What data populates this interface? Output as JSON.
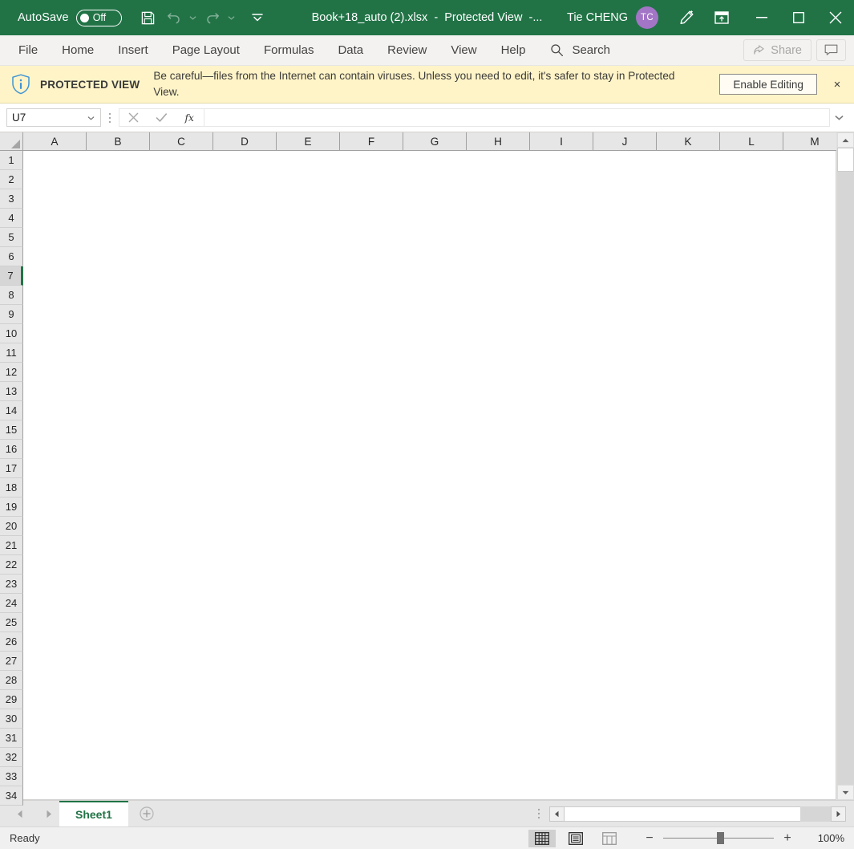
{
  "titlebar": {
    "autosave_label": "AutoSave",
    "autosave_state": "Off",
    "doc_name": "Book+18_auto (2).xlsx",
    "doc_sep1": "-",
    "doc_status": "Protected View",
    "doc_sep2": "-...",
    "user_name": "Tie CHENG",
    "avatar_initials": "TC",
    "qat": [
      {
        "name": "save-icon",
        "label": "Save"
      },
      {
        "name": "undo-icon",
        "label": "Undo"
      },
      {
        "name": "redo-icon",
        "label": "Redo"
      },
      {
        "name": "customize-qat-icon",
        "label": "Customize Quick Access Toolbar"
      }
    ],
    "window": {
      "ink_label": "Draw",
      "ribbon_display_label": "Ribbon Display Options",
      "minimize_label": "Minimize",
      "maximize_label": "Restore Down",
      "close_label": "Close"
    }
  },
  "ribbon": {
    "tabs": [
      {
        "label": "File"
      },
      {
        "label": "Home"
      },
      {
        "label": "Insert"
      },
      {
        "label": "Page Layout"
      },
      {
        "label": "Formulas"
      },
      {
        "label": "Data"
      },
      {
        "label": "Review"
      },
      {
        "label": "View"
      },
      {
        "label": "Help"
      }
    ],
    "search_label": "Search",
    "share_label": "Share",
    "comments_label": "Comments"
  },
  "protected_view": {
    "title": "PROTECTED VIEW",
    "message": "Be careful—files from the Internet can contain viruses. Unless you need to edit, it's safer to stay in Protected View.",
    "enable_button": "Enable Editing",
    "close_label": "×"
  },
  "formula_bar": {
    "name_box_value": "U7",
    "cancel_label": "Cancel",
    "enter_label": "Enter",
    "insert_function_label": "Insert Function",
    "formula_value": "",
    "formula_placeholder": "",
    "expand_label": "Expand Formula Bar"
  },
  "grid": {
    "columns": [
      "A",
      "B",
      "C",
      "D",
      "E",
      "F",
      "G",
      "H",
      "I",
      "J",
      "K",
      "L",
      "M"
    ],
    "rows": [
      1,
      2,
      3,
      4,
      5,
      6,
      7,
      8,
      9,
      10,
      11,
      12,
      13,
      14,
      15,
      16,
      17,
      18,
      19,
      20,
      21,
      22,
      23,
      24,
      25,
      26,
      27,
      28,
      29,
      30,
      31,
      32,
      33,
      34
    ],
    "active_row": 7,
    "active_cell": "U7",
    "select_all_label": "Select All"
  },
  "sheet_tabs": {
    "prev_label": "Previous Sheet",
    "next_label": "Next Sheet",
    "tabs": [
      {
        "label": "Sheet1",
        "active": true
      }
    ],
    "add_sheet_label": "New sheet"
  },
  "status_bar": {
    "status": "Ready",
    "views": [
      {
        "name": "normal-view-icon",
        "label": "Normal",
        "active": true
      },
      {
        "name": "page-layout-view-icon",
        "label": "Page Layout",
        "active": false
      },
      {
        "name": "page-break-preview-icon",
        "label": "Page Break Preview",
        "active": false
      }
    ],
    "zoom_out_label": "−",
    "zoom_in_label": "+",
    "zoom_value": "100%"
  },
  "colors": {
    "brand_green": "#217346",
    "warning_yellow": "#fff4c8",
    "avatar_purple": "#a375c6",
    "ribbon_bg": "#f3f2f1",
    "header_gray": "#e6e6e6"
  }
}
